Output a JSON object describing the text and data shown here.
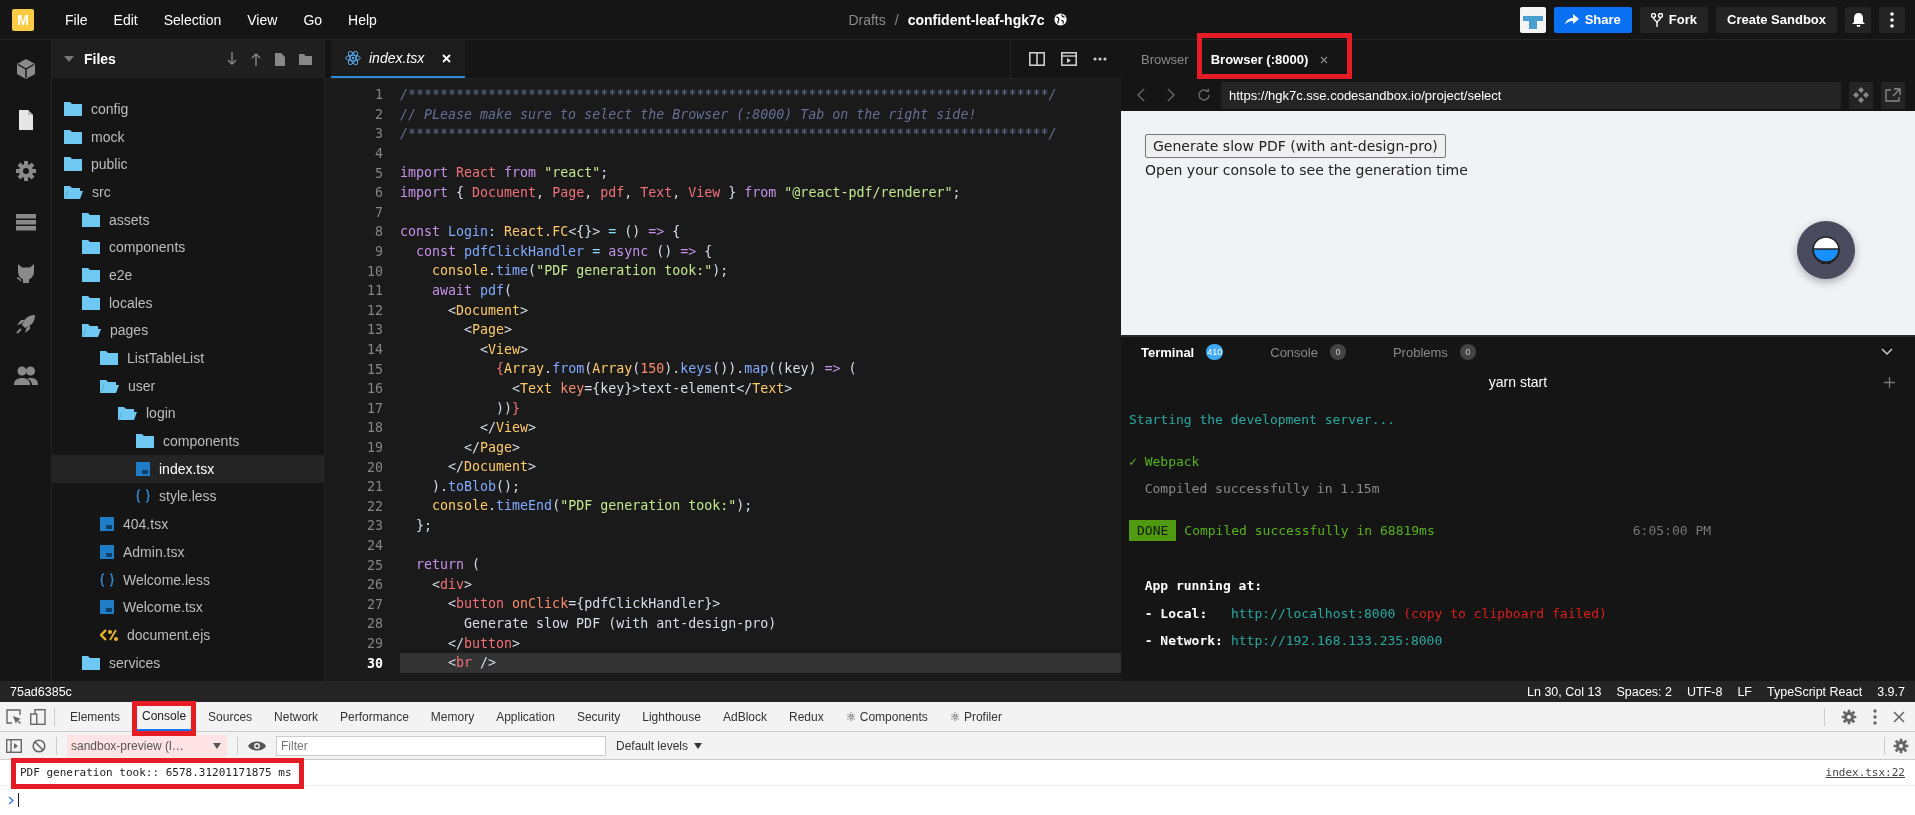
{
  "topbar": {
    "logo": "M",
    "menu": [
      "File",
      "Edit",
      "Selection",
      "View",
      "Go",
      "Help"
    ],
    "breadcrumb": {
      "parent": "Drafts",
      "separator": "/",
      "name": "confident-leaf-hgk7c"
    },
    "actions": [
      {
        "label": "Share",
        "kind": "primary"
      },
      {
        "label": "Fork",
        "kind": "fork"
      },
      {
        "label": "Create Sandbox",
        "kind": "plain"
      }
    ]
  },
  "activity_items": [
    {
      "selected": false
    },
    {
      "selected": true
    },
    {
      "selected": false
    },
    {
      "selected": false
    },
    {
      "selected": false
    },
    {
      "selected": false
    },
    {
      "selected": false
    }
  ],
  "files": {
    "title": "Files",
    "tree": [
      {
        "name": "config",
        "kind": "folder",
        "expanded": false,
        "selected": false
      },
      {
        "name": "mock",
        "kind": "folder",
        "expanded": false,
        "selected": false
      },
      {
        "name": "public",
        "kind": "folder",
        "expanded": false,
        "selected": false
      },
      {
        "name": "src",
        "kind": "folder",
        "expanded": true,
        "selected": false,
        "children": [
          {
            "name": "assets",
            "kind": "folder",
            "expanded": false,
            "selected": false
          },
          {
            "name": "components",
            "kind": "folder",
            "expanded": false,
            "selected": false
          },
          {
            "name": "e2e",
            "kind": "folder",
            "expanded": false,
            "selected": false
          },
          {
            "name": "locales",
            "kind": "folder",
            "expanded": false,
            "selected": false
          },
          {
            "name": "pages",
            "kind": "folder",
            "expanded": true,
            "selected": false,
            "children": [
              {
                "name": "ListTableList",
                "kind": "folder",
                "expanded": false,
                "selected": false
              },
              {
                "name": "user",
                "kind": "folder",
                "expanded": true,
                "selected": false,
                "children": [
                  {
                    "name": "login",
                    "kind": "folder",
                    "expanded": true,
                    "selected": false,
                    "children": [
                      {
                        "name": "components",
                        "kind": "folder",
                        "expanded": false,
                        "selected": false
                      },
                      {
                        "name": "index.tsx",
                        "kind": "ts",
                        "selected": true
                      },
                      {
                        "name": "style.less",
                        "kind": "style",
                        "selected": false
                      }
                    ]
                  }
                ]
              },
              {
                "name": "404.tsx",
                "kind": "ts",
                "selected": false
              },
              {
                "name": "Admin.tsx",
                "kind": "ts",
                "selected": false
              },
              {
                "name": "Welcome.less",
                "kind": "style",
                "selected": false
              },
              {
                "name": "Welcome.tsx",
                "kind": "ts",
                "selected": false
              },
              {
                "name": "document.ejs",
                "kind": "ejs",
                "selected": false
              }
            ]
          },
          {
            "name": "services",
            "kind": "folder",
            "expanded": false,
            "selected": false
          }
        ]
      }
    ]
  },
  "editor": {
    "tab": {
      "label": "index.tsx"
    },
    "lines": [
      {
        "number": "1",
        "current": false,
        "tokens": [
          {
            "kind": "comment",
            "text": "/********************************************************************************/"
          }
        ]
      },
      {
        "number": "2",
        "current": false,
        "tokens": [
          {
            "kind": "comment",
            "text": "// PLease make sure to select the Browser (:8000) Tab on the right side!"
          }
        ]
      },
      {
        "number": "3",
        "current": false,
        "tokens": [
          {
            "kind": "comment",
            "text": "/********************************************************************************/"
          }
        ]
      },
      {
        "number": "4",
        "current": false
      },
      {
        "number": "5",
        "current": false,
        "tokens": [
          {
            "kind": "keyword",
            "text": "import "
          },
          {
            "kind": "name",
            "text": "React "
          },
          {
            "kind": "keyword",
            "text": "from "
          },
          {
            "kind": "string",
            "text": "\"react\""
          },
          {
            "kind": "plain",
            "text": ";"
          }
        ]
      },
      {
        "number": "6",
        "current": false,
        "tokens": [
          {
            "kind": "keyword",
            "text": "import "
          },
          {
            "kind": "plain",
            "text": "{ "
          },
          {
            "kind": "name",
            "text": "Document"
          },
          {
            "kind": "plain",
            "text": ", "
          },
          {
            "kind": "name",
            "text": "Page"
          },
          {
            "kind": "plain",
            "text": ", "
          },
          {
            "kind": "name",
            "text": "pdf"
          },
          {
            "kind": "plain",
            "text": ", "
          },
          {
            "kind": "name",
            "text": "Text"
          },
          {
            "kind": "plain",
            "text": ", "
          },
          {
            "kind": "name",
            "text": "View"
          },
          {
            "kind": "plain",
            "text": " } "
          },
          {
            "kind": "keyword",
            "text": "from "
          },
          {
            "kind": "string",
            "text": "\"@react-pdf/renderer\""
          },
          {
            "kind": "plain",
            "text": ";"
          }
        ]
      },
      {
        "number": "7",
        "current": false
      },
      {
        "number": "8",
        "current": false,
        "tokens": [
          {
            "kind": "keyword",
            "text": "const "
          },
          {
            "kind": "func",
            "text": "Login"
          },
          {
            "kind": "op",
            "text": ": "
          },
          {
            "kind": "type",
            "text": "React.FC"
          },
          {
            "kind": "plain",
            "text": "<{}> "
          },
          {
            "kind": "op",
            "text": "= "
          },
          {
            "kind": "plain",
            "text": "() "
          },
          {
            "kind": "keyword",
            "text": "=> "
          },
          {
            "kind": "plain",
            "text": "{"
          }
        ]
      },
      {
        "number": "9",
        "current": false,
        "tokens": [
          {
            "kind": "keyword",
            "text": "  const "
          },
          {
            "kind": "func",
            "text": "pdfClickHandler "
          },
          {
            "kind": "op",
            "text": "= "
          },
          {
            "kind": "keyword",
            "text": "async "
          },
          {
            "kind": "plain",
            "text": "() "
          },
          {
            "kind": "keyword",
            "text": "=> "
          },
          {
            "kind": "plain",
            "text": "{"
          }
        ]
      },
      {
        "number": "10",
        "current": false,
        "tokens": [
          {
            "kind": "type",
            "text": "    console"
          },
          {
            "kind": "plain",
            "text": "."
          },
          {
            "kind": "func",
            "text": "time"
          },
          {
            "kind": "plain",
            "text": "("
          },
          {
            "kind": "string",
            "text": "\"PDF generation took:\""
          },
          {
            "kind": "plain",
            "text": ");"
          }
        ]
      },
      {
        "number": "11",
        "current": false,
        "tokens": [
          {
            "kind": "keyword",
            "text": "    await "
          },
          {
            "kind": "func",
            "text": "pdf"
          },
          {
            "kind": "plain",
            "text": "("
          }
        ]
      },
      {
        "number": "12",
        "current": false,
        "tokens": [
          {
            "kind": "plain",
            "text": "      <"
          },
          {
            "kind": "type",
            "text": "Document"
          },
          {
            "kind": "plain",
            "text": ">"
          }
        ]
      },
      {
        "number": "13",
        "current": false,
        "tokens": [
          {
            "kind": "plain",
            "text": "        <"
          },
          {
            "kind": "type",
            "text": "Page"
          },
          {
            "kind": "plain",
            "text": ">"
          }
        ]
      },
      {
        "number": "14",
        "current": false,
        "tokens": [
          {
            "kind": "plain",
            "text": "          <"
          },
          {
            "kind": "type",
            "text": "View"
          },
          {
            "kind": "plain",
            "text": ">"
          }
        ]
      },
      {
        "number": "15",
        "current": false,
        "tokens": [
          {
            "kind": "name",
            "text": "            {"
          },
          {
            "kind": "type",
            "text": "Array"
          },
          {
            "kind": "plain",
            "text": "."
          },
          {
            "kind": "func",
            "text": "from"
          },
          {
            "kind": "plain",
            "text": "("
          },
          {
            "kind": "type",
            "text": "Array"
          },
          {
            "kind": "plain",
            "text": "("
          },
          {
            "kind": "number",
            "text": "150"
          },
          {
            "kind": "plain",
            "text": ")."
          },
          {
            "kind": "func",
            "text": "keys"
          },
          {
            "kind": "plain",
            "text": "())."
          },
          {
            "kind": "func",
            "text": "map"
          },
          {
            "kind": "plain",
            "text": "((key) "
          },
          {
            "kind": "keyword",
            "text": "=> "
          },
          {
            "kind": "plain",
            "text": "("
          }
        ]
      },
      {
        "number": "16",
        "current": false,
        "tokens": [
          {
            "kind": "plain",
            "text": "              <"
          },
          {
            "kind": "type",
            "text": "Text "
          },
          {
            "kind": "attr",
            "text": "key"
          },
          {
            "kind": "plain",
            "text": "={key}>text-element</"
          },
          {
            "kind": "type",
            "text": "Text"
          },
          {
            "kind": "plain",
            "text": ">"
          }
        ]
      },
      {
        "number": "17",
        "current": false,
        "tokens": [
          {
            "kind": "plain",
            "text": "            ))"
          },
          {
            "kind": "name",
            "text": "}"
          }
        ]
      },
      {
        "number": "18",
        "current": false,
        "tokens": [
          {
            "kind": "plain",
            "text": "          </"
          },
          {
            "kind": "type",
            "text": "View"
          },
          {
            "kind": "plain",
            "text": ">"
          }
        ]
      },
      {
        "number": "19",
        "current": false,
        "tokens": [
          {
            "kind": "plain",
            "text": "        </"
          },
          {
            "kind": "type",
            "text": "Page"
          },
          {
            "kind": "plain",
            "text": ">"
          }
        ]
      },
      {
        "number": "20",
        "current": false,
        "tokens": [
          {
            "kind": "plain",
            "text": "      </"
          },
          {
            "kind": "type",
            "text": "Document"
          },
          {
            "kind": "plain",
            "text": ">"
          }
        ]
      },
      {
        "number": "21",
        "current": false,
        "tokens": [
          {
            "kind": "plain",
            "text": "    )."
          },
          {
            "kind": "func",
            "text": "toBlob"
          },
          {
            "kind": "plain",
            "text": "();"
          }
        ]
      },
      {
        "number": "22",
        "current": false,
        "tokens": [
          {
            "kind": "type",
            "text": "    console"
          },
          {
            "kind": "plain",
            "text": "."
          },
          {
            "kind": "func",
            "text": "timeEnd"
          },
          {
            "kind": "plain",
            "text": "("
          },
          {
            "kind": "string",
            "text": "\"PDF generation took:\""
          },
          {
            "kind": "plain",
            "text": ");"
          }
        ]
      },
      {
        "number": "23",
        "current": false,
        "tokens": [
          {
            "kind": "plain",
            "text": "  };"
          }
        ]
      },
      {
        "number": "24",
        "current": false
      },
      {
        "number": "25",
        "current": false,
        "tokens": [
          {
            "kind": "keyword",
            "text": "  return "
          },
          {
            "kind": "plain",
            "text": "("
          }
        ]
      },
      {
        "number": "26",
        "current": false,
        "tokens": [
          {
            "kind": "plain",
            "text": "    <"
          },
          {
            "kind": "name",
            "text": "div"
          },
          {
            "kind": "plain",
            "text": ">"
          }
        ]
      },
      {
        "number": "27",
        "current": false,
        "tokens": [
          {
            "kind": "plain",
            "text": "      <"
          },
          {
            "kind": "name",
            "text": "button "
          },
          {
            "kind": "attr",
            "text": "onClick"
          },
          {
            "kind": "plain",
            "text": "={pdfClickHandler}>"
          }
        ]
      },
      {
        "number": "28",
        "current": false,
        "tokens": [
          {
            "kind": "plain",
            "text": "        Generate slow PDF (with ant-design-pro)"
          }
        ]
      },
      {
        "number": "29",
        "current": false,
        "tokens": [
          {
            "kind": "plain",
            "text": "      </"
          },
          {
            "kind": "name",
            "text": "button"
          },
          {
            "kind": "plain",
            "text": ">"
          }
        ]
      },
      {
        "number": "30",
        "current": true,
        "tokens": [
          {
            "kind": "plain",
            "text": "      <"
          },
          {
            "kind": "name",
            "text": "br "
          },
          {
            "kind": "plain",
            "text": "/>"
          }
        ]
      }
    ]
  },
  "preview": {
    "tabs": [
      {
        "label": "Browser",
        "selected": false,
        "closable": false,
        "annotated": false
      },
      {
        "label": "Browser (:8000)",
        "selected": true,
        "closable": true,
        "annotated": true
      }
    ],
    "url": "https://hgk7c.sse.codesandbox.io/project/select",
    "page": {
      "button": "Generate slow PDF (with ant-design-pro)",
      "text": "Open your console to see the generation time"
    }
  },
  "terminal": {
    "tabs": [
      {
        "label": "Terminal",
        "count": "410",
        "selected": true
      },
      {
        "label": "Console",
        "count": "0",
        "selected": false
      },
      {
        "label": "Problems",
        "count": "0",
        "selected": false
      }
    ],
    "title": "yarn start",
    "lines": [
      {
        "kind": "output",
        "segments": [
          {
            "kind": "info",
            "text": "Starting the development server..."
          }
        ]
      },
      {
        "kind": "blank"
      },
      {
        "kind": "output",
        "segments": [
          {
            "kind": "success",
            "text": "✓ Webpack"
          }
        ]
      },
      {
        "kind": "output",
        "segments": [
          {
            "kind": "muted",
            "text": "  Compiled successfully in 1.15m"
          }
        ]
      },
      {
        "kind": "blank"
      },
      {
        "kind": "output",
        "segments": [
          {
            "kind": "badge",
            "text": "DONE"
          },
          {
            "kind": "success",
            "text": "Compiled successfully in 68819ms"
          },
          {
            "kind": "time",
            "text": "6:05:00 PM"
          }
        ]
      },
      {
        "kind": "blank"
      },
      {
        "kind": "blank"
      },
      {
        "kind": "output",
        "segments": [
          {
            "kind": "bold",
            "text": "  App running at:"
          }
        ]
      },
      {
        "kind": "output",
        "segments": [
          {
            "kind": "bold",
            "text": "  - Local:"
          },
          {
            "kind": "link",
            "text": "  http://localhost:8000"
          },
          {
            "kind": "error",
            "text": "(copy to clipboard failed)"
          }
        ]
      },
      {
        "kind": "output",
        "segments": [
          {
            "kind": "bold",
            "text": "  - Network:"
          },
          {
            "kind": "link",
            "text": "http://192.168.133.235:8000"
          }
        ]
      }
    ]
  },
  "status_bar": {
    "left": "75ad6385c",
    "items": [
      "Ln 30, Col 13",
      "Spaces: 2",
      "UTF-8",
      "LF",
      "TypeScript React",
      "3.9.7"
    ]
  },
  "devtools": {
    "tabs": [
      {
        "label": "Elements",
        "selected": false,
        "annotated": false
      },
      {
        "label": "Console",
        "selected": true,
        "annotated": true
      },
      {
        "label": "Sources",
        "selected": false,
        "annotated": false
      },
      {
        "label": "Network",
        "selected": false,
        "annotated": false
      },
      {
        "label": "Performance",
        "selected": false,
        "annotated": false
      },
      {
        "label": "Memory",
        "selected": false,
        "annotated": false
      },
      {
        "label": "Application",
        "selected": false,
        "annotated": false
      },
      {
        "label": "Security",
        "selected": false,
        "annotated": false
      },
      {
        "label": "Lighthouse",
        "selected": false,
        "annotated": false
      },
      {
        "label": "AdBlock",
        "selected": false,
        "annotated": false
      },
      {
        "label": "Redux",
        "selected": false,
        "annotated": false
      },
      {
        "label": "⚛ Components",
        "selected": false,
        "annotated": false
      },
      {
        "label": "⚛ Profiler",
        "selected": false,
        "annotated": false
      }
    ],
    "context": "sandbox-preview (l…",
    "filter_placeholder": "Filter",
    "levels": "Default levels",
    "log": [
      {
        "message": "PDF generation took:: 6578.31201171875 ms",
        "source": "index.tsx:22",
        "annotated": true
      }
    ]
  }
}
